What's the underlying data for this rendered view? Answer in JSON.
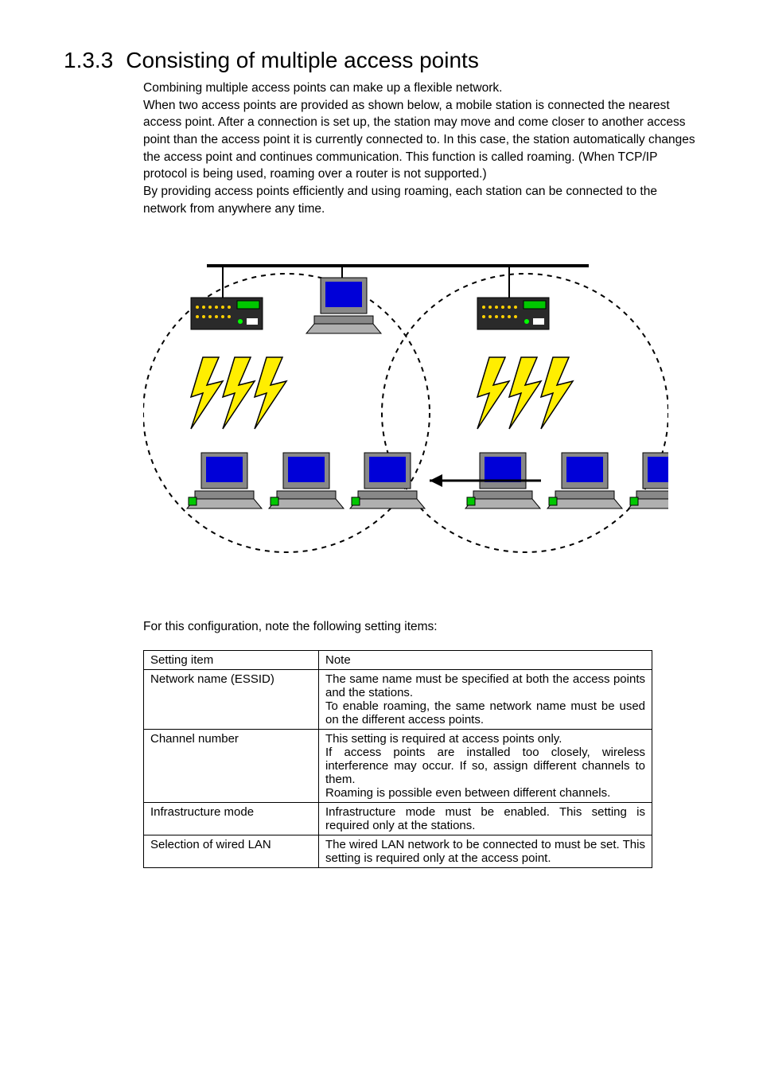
{
  "heading": {
    "number": "1.3.3",
    "title": "Consisting of multiple access points"
  },
  "body_paragraph": "Combining multiple access points can make up a flexible network.\nWhen two access points are provided as shown below, a mobile station is connected the nearest access point.  After a connection is set up, the station may move and come closer to another access point than the access point it is currently connected to.  In this case, the station automatically changes the access point and continues communication.  This function is called roaming. (When TCP/IP protocol is being used, roaming over a router is not supported.)\nBy providing access points efficiently and using roaming, each station can be connected to the network from anywhere any time.",
  "note_line": "For this configuration, note the following setting items:",
  "table": {
    "header": {
      "item": "Setting item",
      "note": "Note"
    },
    "rows": [
      {
        "item": "Network name (ESSID)",
        "note": "The same name must be specified at both the access points and the stations.\nTo enable roaming, the same network name must be used on the different access points."
      },
      {
        "item": "Channel number",
        "note": "This setting is required at access points only.\nIf access points are installed too closely, wireless interference may occur.  If so, assign different channels to them.\nRoaming is possible even between different channels."
      },
      {
        "item": "Infrastructure mode",
        "note": "Infrastructure mode must be enabled.  This setting is required only at the stations."
      },
      {
        "item": "Selection of wired LAN",
        "note": "The wired LAN network to be connected to must be set.  This setting is required only at the access point."
      }
    ]
  }
}
